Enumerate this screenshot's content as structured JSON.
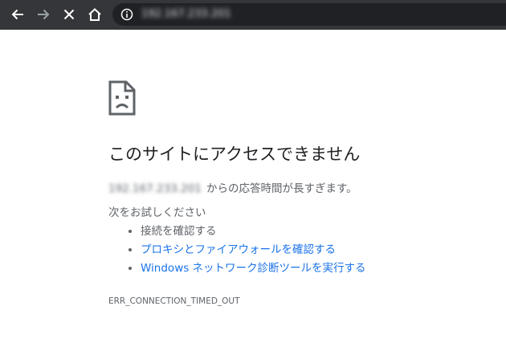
{
  "toolbar": {
    "back_icon": "arrow-left-icon",
    "forward_icon": "arrow-right-icon",
    "stop_icon": "close-icon",
    "home_icon": "home-icon",
    "info_icon": "info-icon",
    "url": "192.167.233.201"
  },
  "error_page": {
    "icon": "sad-document-icon",
    "title": "このサイトにアクセスできません",
    "host": "192.167.233.201",
    "summary_suffix": "からの応答時間が長すぎます。",
    "try_label": "次をお試しください",
    "suggestions": [
      {
        "text": "接続を確認する",
        "is_link": false
      },
      {
        "text": "プロキシとファイアウォールを確認する",
        "is_link": true
      },
      {
        "text": "Windows ネットワーク診断ツールを実行する",
        "is_link": true
      }
    ],
    "error_code": "ERR_CONNECTION_TIMED_OUT"
  },
  "colors": {
    "toolbar_bg": "#35363a",
    "omnibox_bg": "#202124",
    "link": "#1a73e8",
    "heading": "#202124",
    "body_text": "#5f6368"
  }
}
